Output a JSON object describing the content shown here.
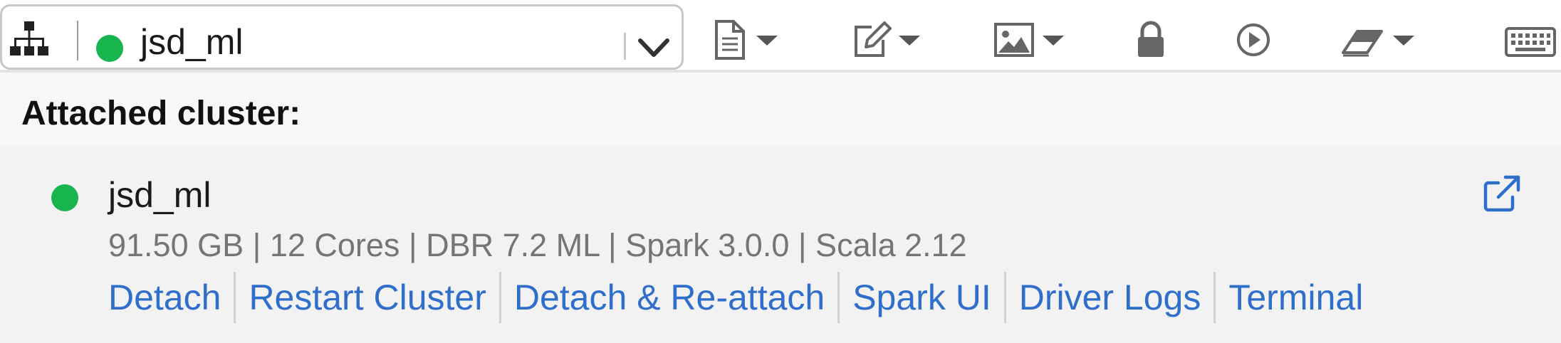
{
  "toolbar": {
    "selected_cluster": "jsd_ml",
    "status_color": "#18b54e",
    "icons": [
      "hierarchy-icon",
      "file-icon",
      "edit-icon",
      "image-icon",
      "lock-icon",
      "play-icon",
      "eraser-icon",
      "keyboard-icon"
    ]
  },
  "panel": {
    "title": "Attached cluster:",
    "cluster": {
      "name": "jsd_ml",
      "meta": "91.50 GB | 12 Cores | DBR 7.2 ML | Spark 3.0.0 | Scala 2.12",
      "actions": [
        "Detach",
        "Restart Cluster",
        "Detach & Re-attach",
        "Spark UI",
        "Driver Logs",
        "Terminal"
      ],
      "link_color": "#2f6ecb"
    }
  }
}
